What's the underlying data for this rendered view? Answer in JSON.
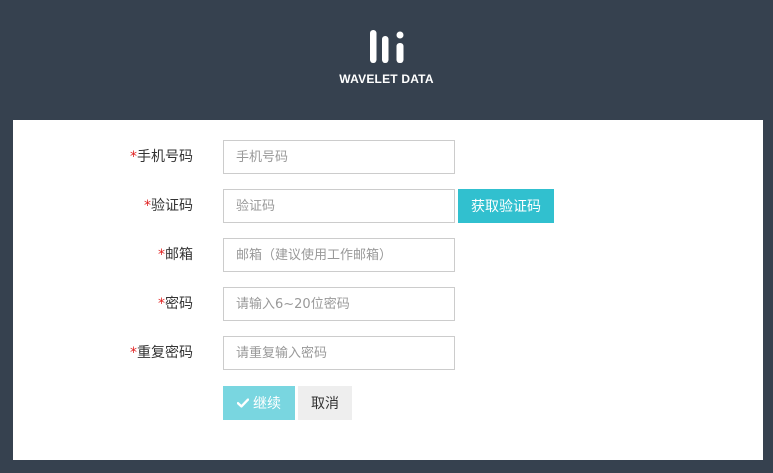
{
  "header": {
    "brand_name": "WAVELET DATA",
    "logo_icon": "wavelet-bars-logo"
  },
  "form": {
    "fields": [
      {
        "required_mark": "*",
        "label": "手机号码",
        "placeholder": "手机号码",
        "value": ""
      },
      {
        "required_mark": "*",
        "label": "验证码",
        "placeholder": "验证码",
        "value": ""
      },
      {
        "required_mark": "*",
        "label": "邮箱",
        "placeholder": "邮箱（建议使用工作邮箱）",
        "value": ""
      },
      {
        "required_mark": "*",
        "label": "密码",
        "placeholder": "请输入6~20位密码",
        "value": ""
      },
      {
        "required_mark": "*",
        "label": "重复密码",
        "placeholder": "请重复输入密码",
        "value": ""
      }
    ],
    "get_code_label": "获取验证码",
    "continue_label": "继续",
    "continue_icon": "check-icon",
    "cancel_label": "取消"
  },
  "colors": {
    "background": "#36414f",
    "accent": "#31c0cf",
    "accent_light": "#79d6e0",
    "required": "#e02020"
  }
}
